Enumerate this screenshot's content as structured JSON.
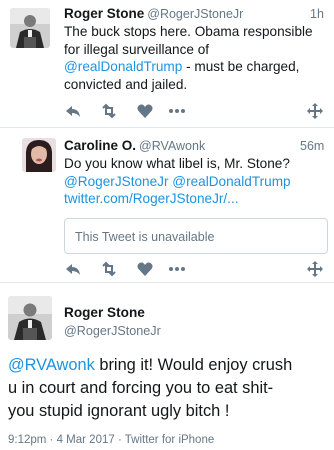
{
  "tweets": [
    {
      "name": "Roger Stone",
      "handle": "@RogerJStoneJr",
      "time": "1h",
      "text_a": "The buck stops here. Obama responsible",
      "text_b": "for illegal surveillance of",
      "mention": "@realDonaldTrump",
      "text_c": " - must be charged,",
      "text_d": "convicted and jailed."
    },
    {
      "name": "Caroline O.",
      "handle": "@RVAwonk",
      "time": "56m",
      "text_a": "Do you know what libel is, Mr. Stone?",
      "mention_1": "@RogerJStoneJr",
      "mention_2": "@realDonaldTrump",
      "link": "twitter.com/RogerJStoneJr/...",
      "quote": "This Tweet is unavailable"
    }
  ],
  "main_tweet": {
    "name": "Roger Stone",
    "handle": "@RogerJStoneJr",
    "mention": "@RVAwonk",
    "text_a": " bring it! Would enjoy crush",
    "text_b": "u in court and forcing you to eat shit-",
    "text_c": "you stupid ignorant ugly bitch !",
    "meta": "9:12pm · 4 Mar 2017 · Twitter for iPhone"
  },
  "icons": {
    "reply": "reply-icon",
    "retweet": "retweet-icon",
    "like": "heart-icon",
    "more": "more-icon",
    "move": "move-icon"
  },
  "colors": {
    "link": "#1b95e0",
    "icon": "#657786",
    "text": "#14171a"
  }
}
